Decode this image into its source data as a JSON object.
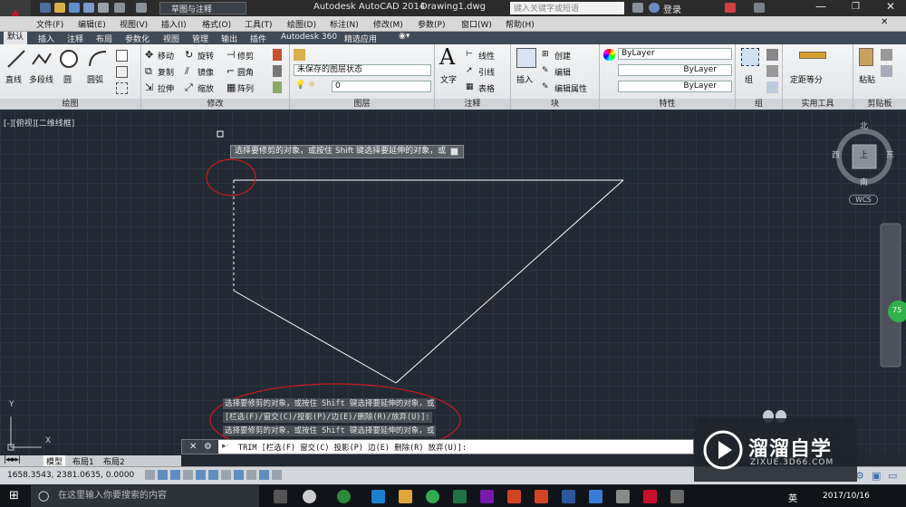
{
  "title_bar": {
    "workspace": "草图与注释",
    "app": "Autodesk AutoCAD 2014",
    "file": "Drawing1.dwg",
    "search_placeholder": "键入关键字或短语",
    "login": "登录"
  },
  "menu": [
    "文件(F)",
    "编辑(E)",
    "视图(V)",
    "插入(I)",
    "格式(O)",
    "工具(T)",
    "绘图(D)",
    "标注(N)",
    "修改(M)",
    "参数(P)",
    "窗口(W)",
    "帮助(H)"
  ],
  "tabs": [
    "默认",
    "插入",
    "注释",
    "布局",
    "参数化",
    "视图",
    "管理",
    "输出",
    "插件",
    "Autodesk 360",
    "精选应用"
  ],
  "ribbon": {
    "draw": {
      "label": "绘图",
      "line": "直线",
      "polyline": "多段线",
      "circle": "圆",
      "arc": "圆弧"
    },
    "modify": {
      "label": "修改",
      "move": "移动",
      "rotate": "旋转",
      "trim": "修剪",
      "copy": "复制",
      "mirror": "镜像",
      "fillet": "圆角",
      "stretch": "拉伸",
      "scale": "缩放",
      "array": "阵列"
    },
    "layers": {
      "label": "图层",
      "state": "未保存的图层状态",
      "current": "0"
    },
    "annotation": {
      "label": "注释",
      "text": "文字",
      "linear": "线性",
      "leader": "引线",
      "table": "表格"
    },
    "block": {
      "label": "块",
      "insert": "插入",
      "create": "创建",
      "edit": "编辑",
      "edit_attr": "编辑属性"
    },
    "properties": {
      "label": "特性",
      "color": "ByLayer",
      "linetype": "ByLayer",
      "lineweight": "ByLayer"
    },
    "groups": {
      "label": "组",
      "group": "组"
    },
    "utilities": {
      "label": "实用工具",
      "measure": "定距等分"
    },
    "clipboard": {
      "label": "剪贴板",
      "paste": "粘贴"
    }
  },
  "viewport": {
    "label": "[-][俯视][二维线框]",
    "tooltip": "选择要修剪的对象，或按住 Shift 键选择要延伸的对象，或",
    "viewcube": {
      "north": "北",
      "south": "南",
      "east": "东",
      "west": "西",
      "top": "上",
      "wcs": "WCS"
    },
    "ucs_x": "X",
    "ucs_y": "Y"
  },
  "command_history": [
    "选择要修剪的对象，或按住 Shift 键选择要延伸的对象，或",
    "[栏选(F)/窗交(C)/投影(P)/边(E)/删除(R)/放弃(U)]:",
    "选择要修剪的对象，或按住 Shift 键选择要延伸的对象，或"
  ],
  "command_line": "TRIM [栏选(F) 窗交(C) 投影(P) 边(E) 删除(R) 放弃(U)]:",
  "layout_tabs": [
    "模型",
    "布局1",
    "布局2"
  ],
  "status": {
    "coords": "1658.3543, 2381.0635, 0.0000"
  },
  "taskbar": {
    "search": "在这里输入你要搜索的内容",
    "time": "2017/10/16",
    "ime": "英"
  },
  "watermark": {
    "name": "溜溜自学",
    "url": "ZIXUE.3D66.COM"
  },
  "badge": "75",
  "colors": {
    "ribbon": "#e4e6ea",
    "viewport": "#222933",
    "annotation": "#cc1a1a",
    "geometry": "#ffffff",
    "appred": "#c8102e"
  }
}
